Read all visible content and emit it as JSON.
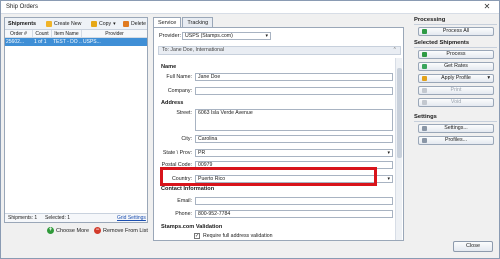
{
  "window": {
    "title": "Ship Orders",
    "close_glyph": "✕"
  },
  "shipments": {
    "heading": "Shipments",
    "toolbar": {
      "create_new": "Create New",
      "copy": "Copy",
      "copy_arrow": "▾",
      "delete": "Delete"
    },
    "columns": [
      "Order #",
      "Count",
      "Item Name",
      "Provider"
    ],
    "rows": [
      {
        "order": "25602...",
        "count": "1 of 1",
        "item": "TEST - DO ...",
        "provider": "USPS..."
      }
    ],
    "footer": {
      "shipments": "Shipments: 1",
      "selected": "Selected: 1",
      "grid_settings": "Grid Settings"
    },
    "choose_more": "Choose More",
    "remove_from_list": "Remove From List"
  },
  "tabs": [
    "Service",
    "Tracking"
  ],
  "service": {
    "provider_label": "Provider:",
    "provider_value": "USPS (Stamps.com)",
    "to_bar": "To:  Jane Doe, International",
    "to_chev": "⌃",
    "sections": {
      "name": "Name",
      "address": "Address",
      "contact": "Contact Information",
      "validation": "Stamps.com Validation"
    },
    "fields": {
      "full_name": {
        "label": "Full Name:",
        "value": "Jane Doe"
      },
      "company": {
        "label": "Company:",
        "value": ""
      },
      "street": {
        "label": "Street:",
        "value": "6063 Isla Verde Avenue"
      },
      "city": {
        "label": "City:",
        "value": "Carolina"
      },
      "state": {
        "label": "State \\ Prov:",
        "value": "PR"
      },
      "postal": {
        "label": "Postal Code:",
        "value": "00979"
      },
      "country": {
        "label": "Country:",
        "value": "Puerto Rico"
      },
      "email": {
        "label": "Email:",
        "value": ""
      },
      "phone": {
        "label": "Phone:",
        "value": "800-952-7784"
      }
    },
    "require_validation": "Require full address validation"
  },
  "right": {
    "processing": "Processing",
    "process_all": "Process All",
    "selected_shipments": "Selected Shipments",
    "process": "Process",
    "get_rates": "Get Rates",
    "apply_profile": "Apply Profile",
    "apply_profile_arrow": "▾",
    "print": "Print",
    "void": "Void",
    "settings": "Settings",
    "settings_btn": "Settings...",
    "profiles_btn": "Profiles..."
  },
  "close": "Close",
  "colors": {
    "highlight": "#d8141b",
    "selection": "#3f8fd6"
  }
}
